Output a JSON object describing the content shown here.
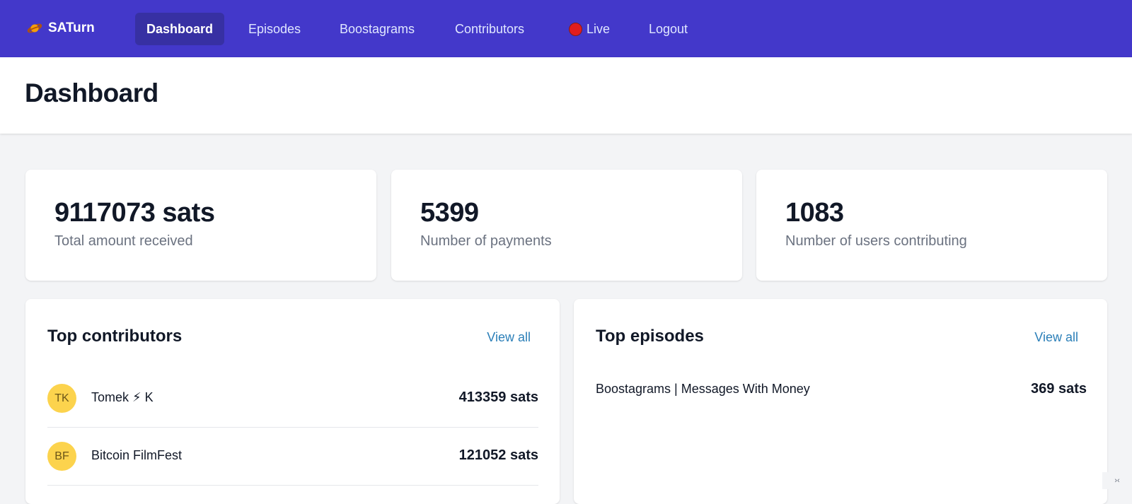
{
  "nav": {
    "brand": "SATurn",
    "brand_icon": "ringed-planet-icon",
    "items": [
      {
        "label": "Dashboard",
        "active": true
      },
      {
        "label": "Episodes"
      },
      {
        "label": "Boostagrams"
      },
      {
        "label": "Contributors"
      },
      {
        "label": "Live",
        "icon": "red-circle-icon"
      },
      {
        "label": "Logout"
      }
    ],
    "bg_color": "#4338ca",
    "active_color": "#3730a3"
  },
  "page": {
    "title": "Dashboard"
  },
  "stats": [
    {
      "value": "9117073 sats",
      "label": "Total amount received"
    },
    {
      "value": "5399",
      "label": "Number of payments"
    },
    {
      "value": "1083",
      "label": "Number of users contributing"
    }
  ],
  "top_contributors": {
    "title": "Top contributors",
    "view_all": "View all",
    "rows": [
      {
        "initials": "TK",
        "name": "Tomek ⚡ K",
        "amount": "413359 sats"
      },
      {
        "initials": "BF",
        "name": "Bitcoin FilmFest",
        "amount": "121052 sats"
      }
    ]
  },
  "top_episodes": {
    "title": "Top episodes",
    "view_all": "View all",
    "rows": [
      {
        "name": "Boostagrams | Messages With Money",
        "amount": "369 sats"
      }
    ]
  },
  "corner_widget": {
    "label": "›‹"
  }
}
